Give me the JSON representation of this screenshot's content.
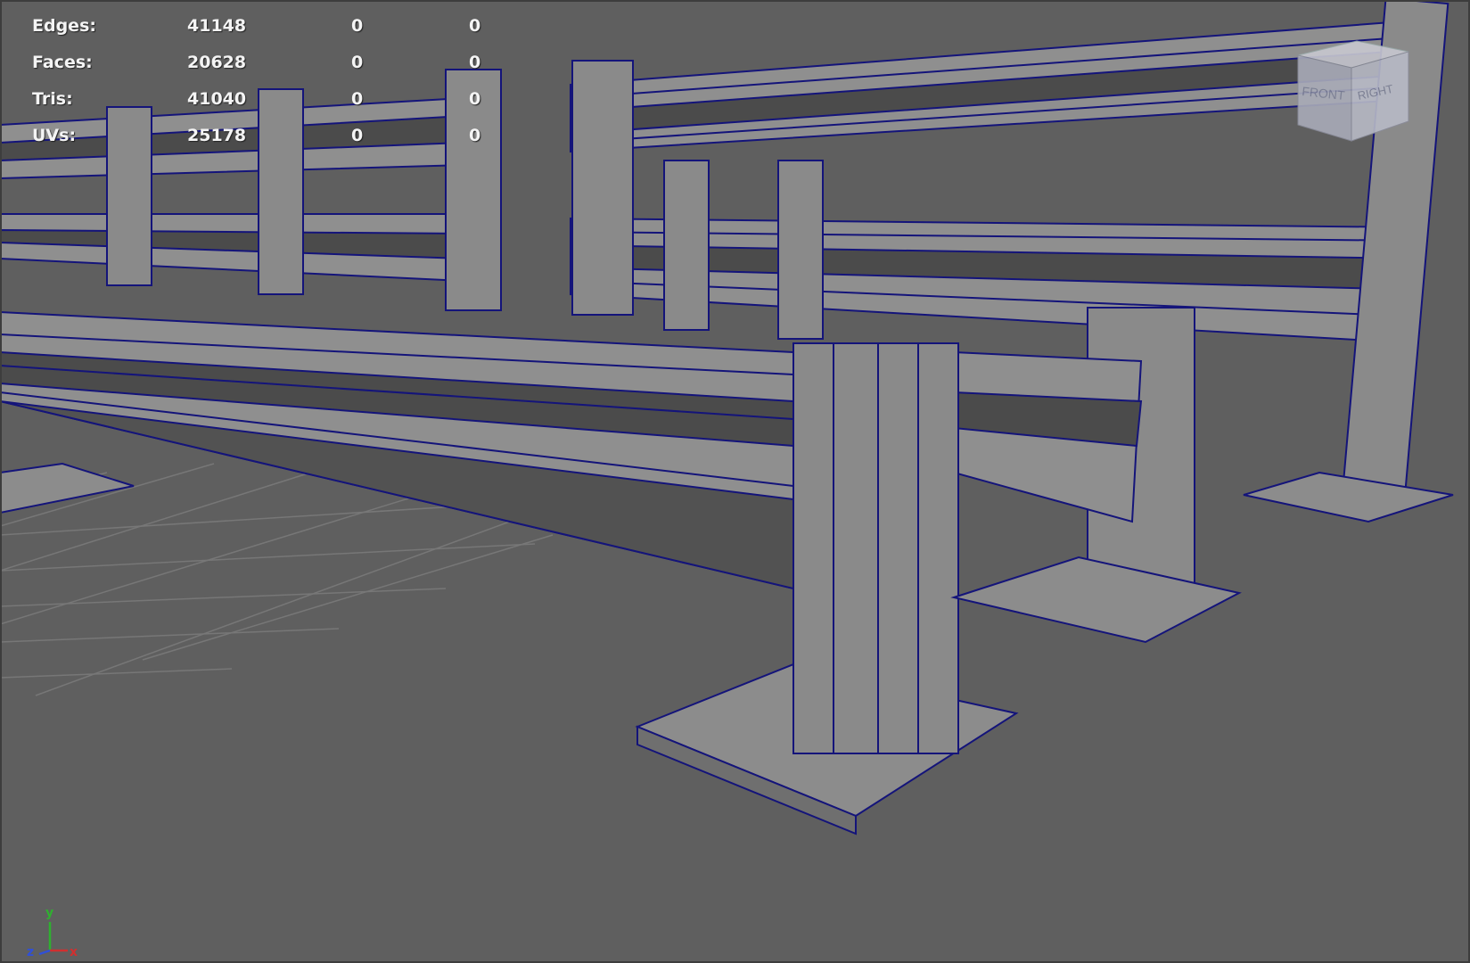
{
  "hud": {
    "rows": [
      {
        "label": "Edges:",
        "total": "41148",
        "selected": "0",
        "component": "0"
      },
      {
        "label": "Faces:",
        "total": "20628",
        "selected": "0",
        "component": "0"
      },
      {
        "label": "Tris:",
        "total": "41040",
        "selected": "0",
        "component": "0"
      },
      {
        "label": "UVs:",
        "total": "25178",
        "selected": "0",
        "component": "0"
      }
    ]
  },
  "viewcube": {
    "front": "FRONT",
    "right": "RIGHT"
  },
  "axis": {
    "x": "x",
    "y": "y",
    "z": "z"
  },
  "colors": {
    "background": "#5f5f5f",
    "wire": "#1a1a7a",
    "axis_x": "#d03030",
    "axis_y": "#2fb030",
    "axis_z": "#3050d8"
  }
}
